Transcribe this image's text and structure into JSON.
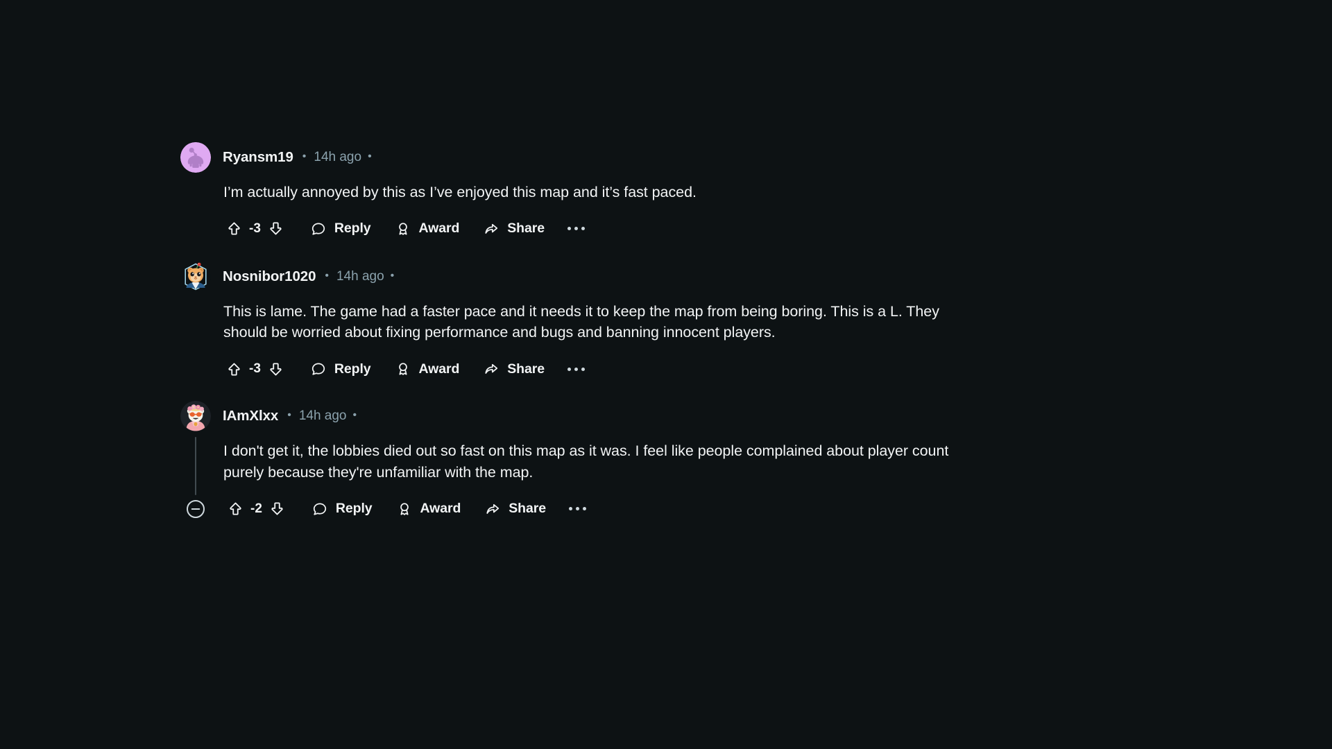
{
  "theme": {
    "background": "#0d1214",
    "text_primary": "#f2f4f5",
    "text_muted": "#8ba2ad",
    "thread_line": "#414b50"
  },
  "labels": {
    "reply": "Reply",
    "award": "Award",
    "share": "Share",
    "separator": "•",
    "overflow": "…"
  },
  "comments": [
    {
      "id": "comment-1",
      "username": "Ryansm19",
      "timestamp": "14h ago",
      "avatar": "snoo-purple-default-avatar",
      "body": "I’m actually annoyed by this as I’ve enjoyed this map and it’s fast paced.",
      "score": "-3",
      "collapsible": false
    },
    {
      "id": "comment-2",
      "username": "Nosnibor1020",
      "timestamp": "14h ago",
      "avatar": "snoo-orange-hamster-avatar",
      "body": "This is lame. The game had a faster pace and it needs it to keep the map from being boring. This is a L. They should be worried about fixing performance and bugs and banning innocent players.",
      "score": "-3",
      "collapsible": false
    },
    {
      "id": "comment-3",
      "username": "IAmXlxx",
      "timestamp": "14h ago",
      "avatar": "snoo-flower-crown-avatar",
      "body": "I don't get it, the lobbies died out so fast on this map as it was. I feel like people complained about player count purely because they're unfamiliar with the map.",
      "score": "-2",
      "collapsible": true
    }
  ]
}
